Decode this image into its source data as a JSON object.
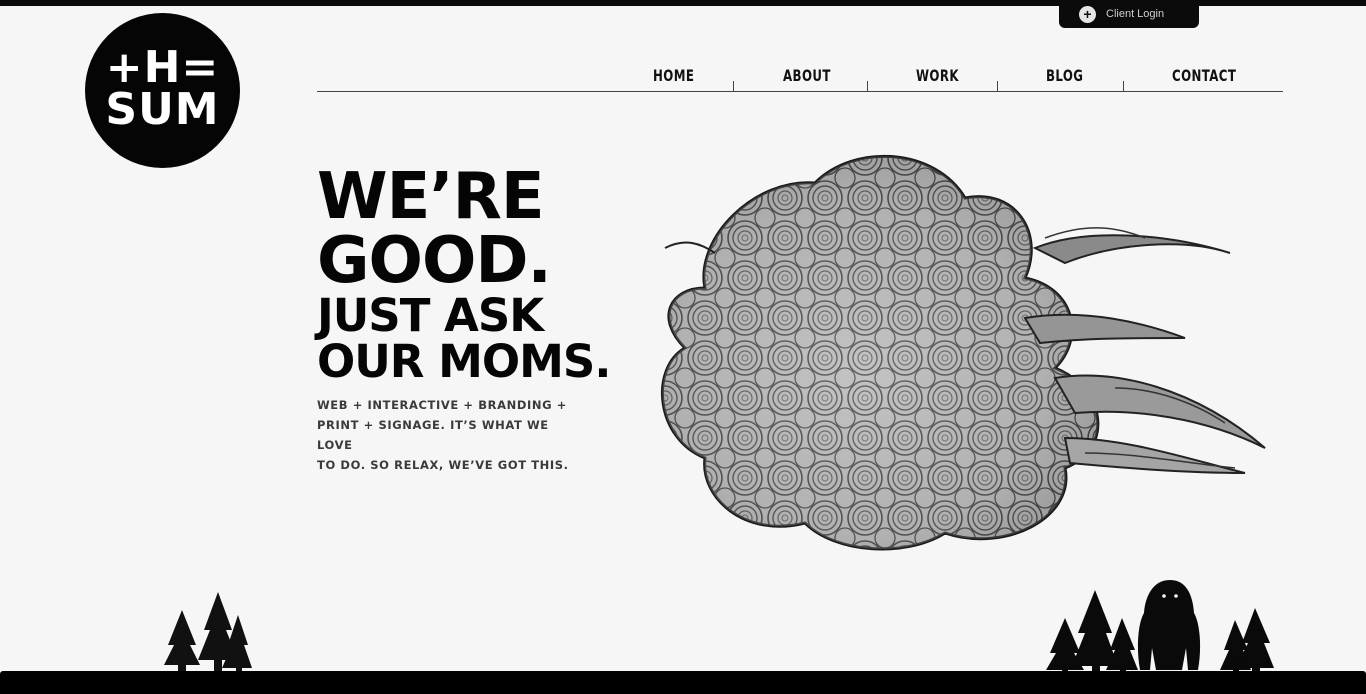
{
  "header": {
    "client_login_label": "Client Login",
    "logo_text_line1": "+H=",
    "logo_text_line2": "SUM"
  },
  "nav": {
    "items": [
      {
        "label": "HOME"
      },
      {
        "label": "ABOUT"
      },
      {
        "label": "WORK"
      },
      {
        "label": "BLOG"
      },
      {
        "label": "CONTACT"
      }
    ]
  },
  "hero": {
    "line1": "WE’RE",
    "line2": "GOOD.",
    "line3": "JUST ASK",
    "line4": "OUR MOMS.",
    "tagline_line1": "WEB + INTERACTIVE + BRANDING +",
    "tagline_line2": "PRINT + SIGNAGE. IT’S WHAT WE LOVE",
    "tagline_line3": "TO DO. SO RELAX, WE’VE GOT THIS."
  },
  "icons": {
    "client_login": "plus-icon",
    "illustration": "swirl-cloud-illustration",
    "footer_left": "pine-trees-icon",
    "footer_right": "bigfoot-trees-icon"
  },
  "colors": {
    "background": "#f6f6f6",
    "ink": "#050505",
    "bars": "#000000"
  }
}
